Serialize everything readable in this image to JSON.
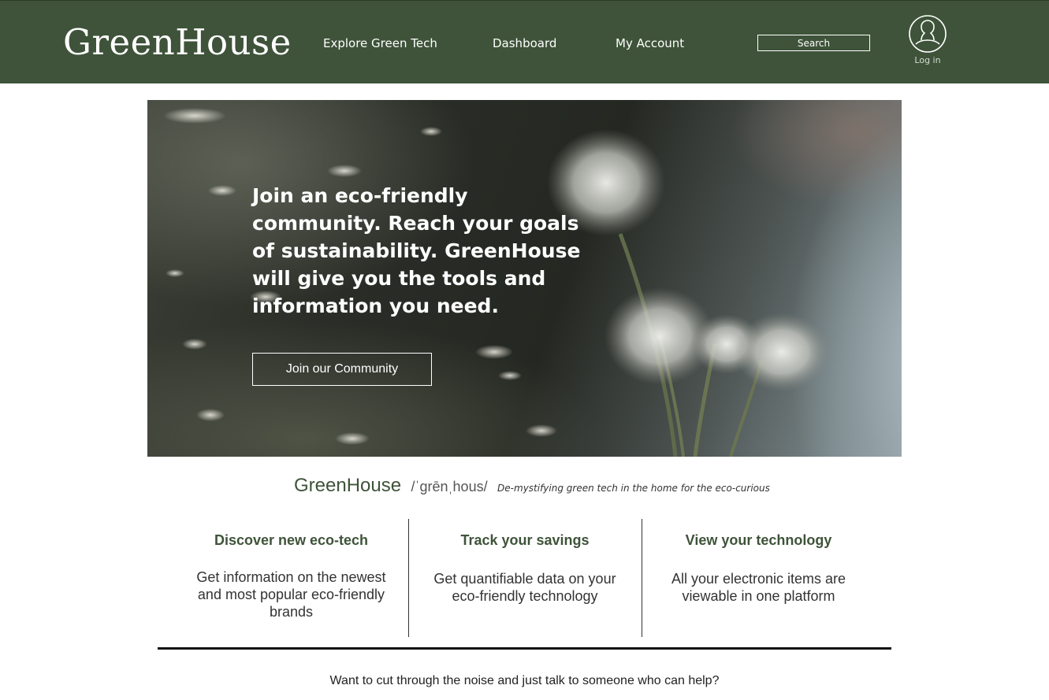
{
  "header": {
    "logo": "GreenHouse",
    "nav": [
      "Explore Green Tech",
      "Dashboard",
      "My Account"
    ],
    "search_placeholder": "Search",
    "login_label": "Log in",
    "login_icon": "user-circle-icon"
  },
  "hero": {
    "text": "Join an eco-friendly community.\nReach your goals of sustainability.\nGreenHouse will give you the tools and information you need.",
    "button": "Join our Community",
    "image": "dandelion-seedheads-photo"
  },
  "brand": {
    "name": "GreenHouse",
    "pronunciation": "/ˈgrēnˌhous/",
    "tagline": "De-mystifying green tech in the home for the eco-curious"
  },
  "features": [
    {
      "title": "Discover new eco-tech",
      "body": "Get information on the newest and most popular eco-friendly brands"
    },
    {
      "title": "Track your savings",
      "body": "Get quantifiable data on your eco-friendly technology"
    },
    {
      "title": "View your technology",
      "body": "All your electronic items are viewable in one platform"
    }
  ],
  "cta": "Want to cut through the noise and just talk to someone who can help?",
  "colors": {
    "brand_green": "#3e5339",
    "text": "#333333",
    "background": "#ffffff"
  }
}
